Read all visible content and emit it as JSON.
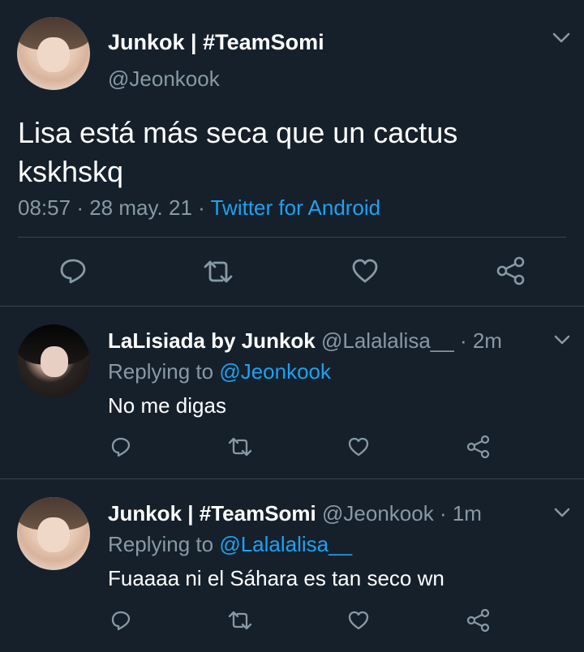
{
  "main_tweet": {
    "name": "Junkok | #TeamSomi",
    "handle": "@Jeonkook",
    "text_line1": "Lisa está más seca que un cactus",
    "text_line2": "kskhskq",
    "time": "08:57",
    "sep1": "·",
    "date": "28 may. 21",
    "sep2": "·",
    "source": "Twitter for Android"
  },
  "replies": [
    {
      "name": "LaLisiada by Junkok",
      "handle": "@Lalalalisa__",
      "age": "· 2m",
      "replying_prefix": "Replying to",
      "replying_to": "@Jeonkook",
      "text": "No me digas"
    },
    {
      "name": "Junkok | #TeamSomi",
      "handle": "@Jeonkook",
      "age": "· 1m",
      "replying_prefix": "Replying to",
      "replying_to": "@Lalalalisa__",
      "text": "Fuaaaa ni el Sáhara es tan seco wn"
    }
  ],
  "colors": {
    "background": "#15202b",
    "secondary_text": "#8899a6",
    "accent": "#1da1f2",
    "divider": "#38444d"
  },
  "icons": [
    "chevron-down-icon",
    "reply-icon",
    "retweet-icon",
    "like-icon",
    "share-icon"
  ]
}
